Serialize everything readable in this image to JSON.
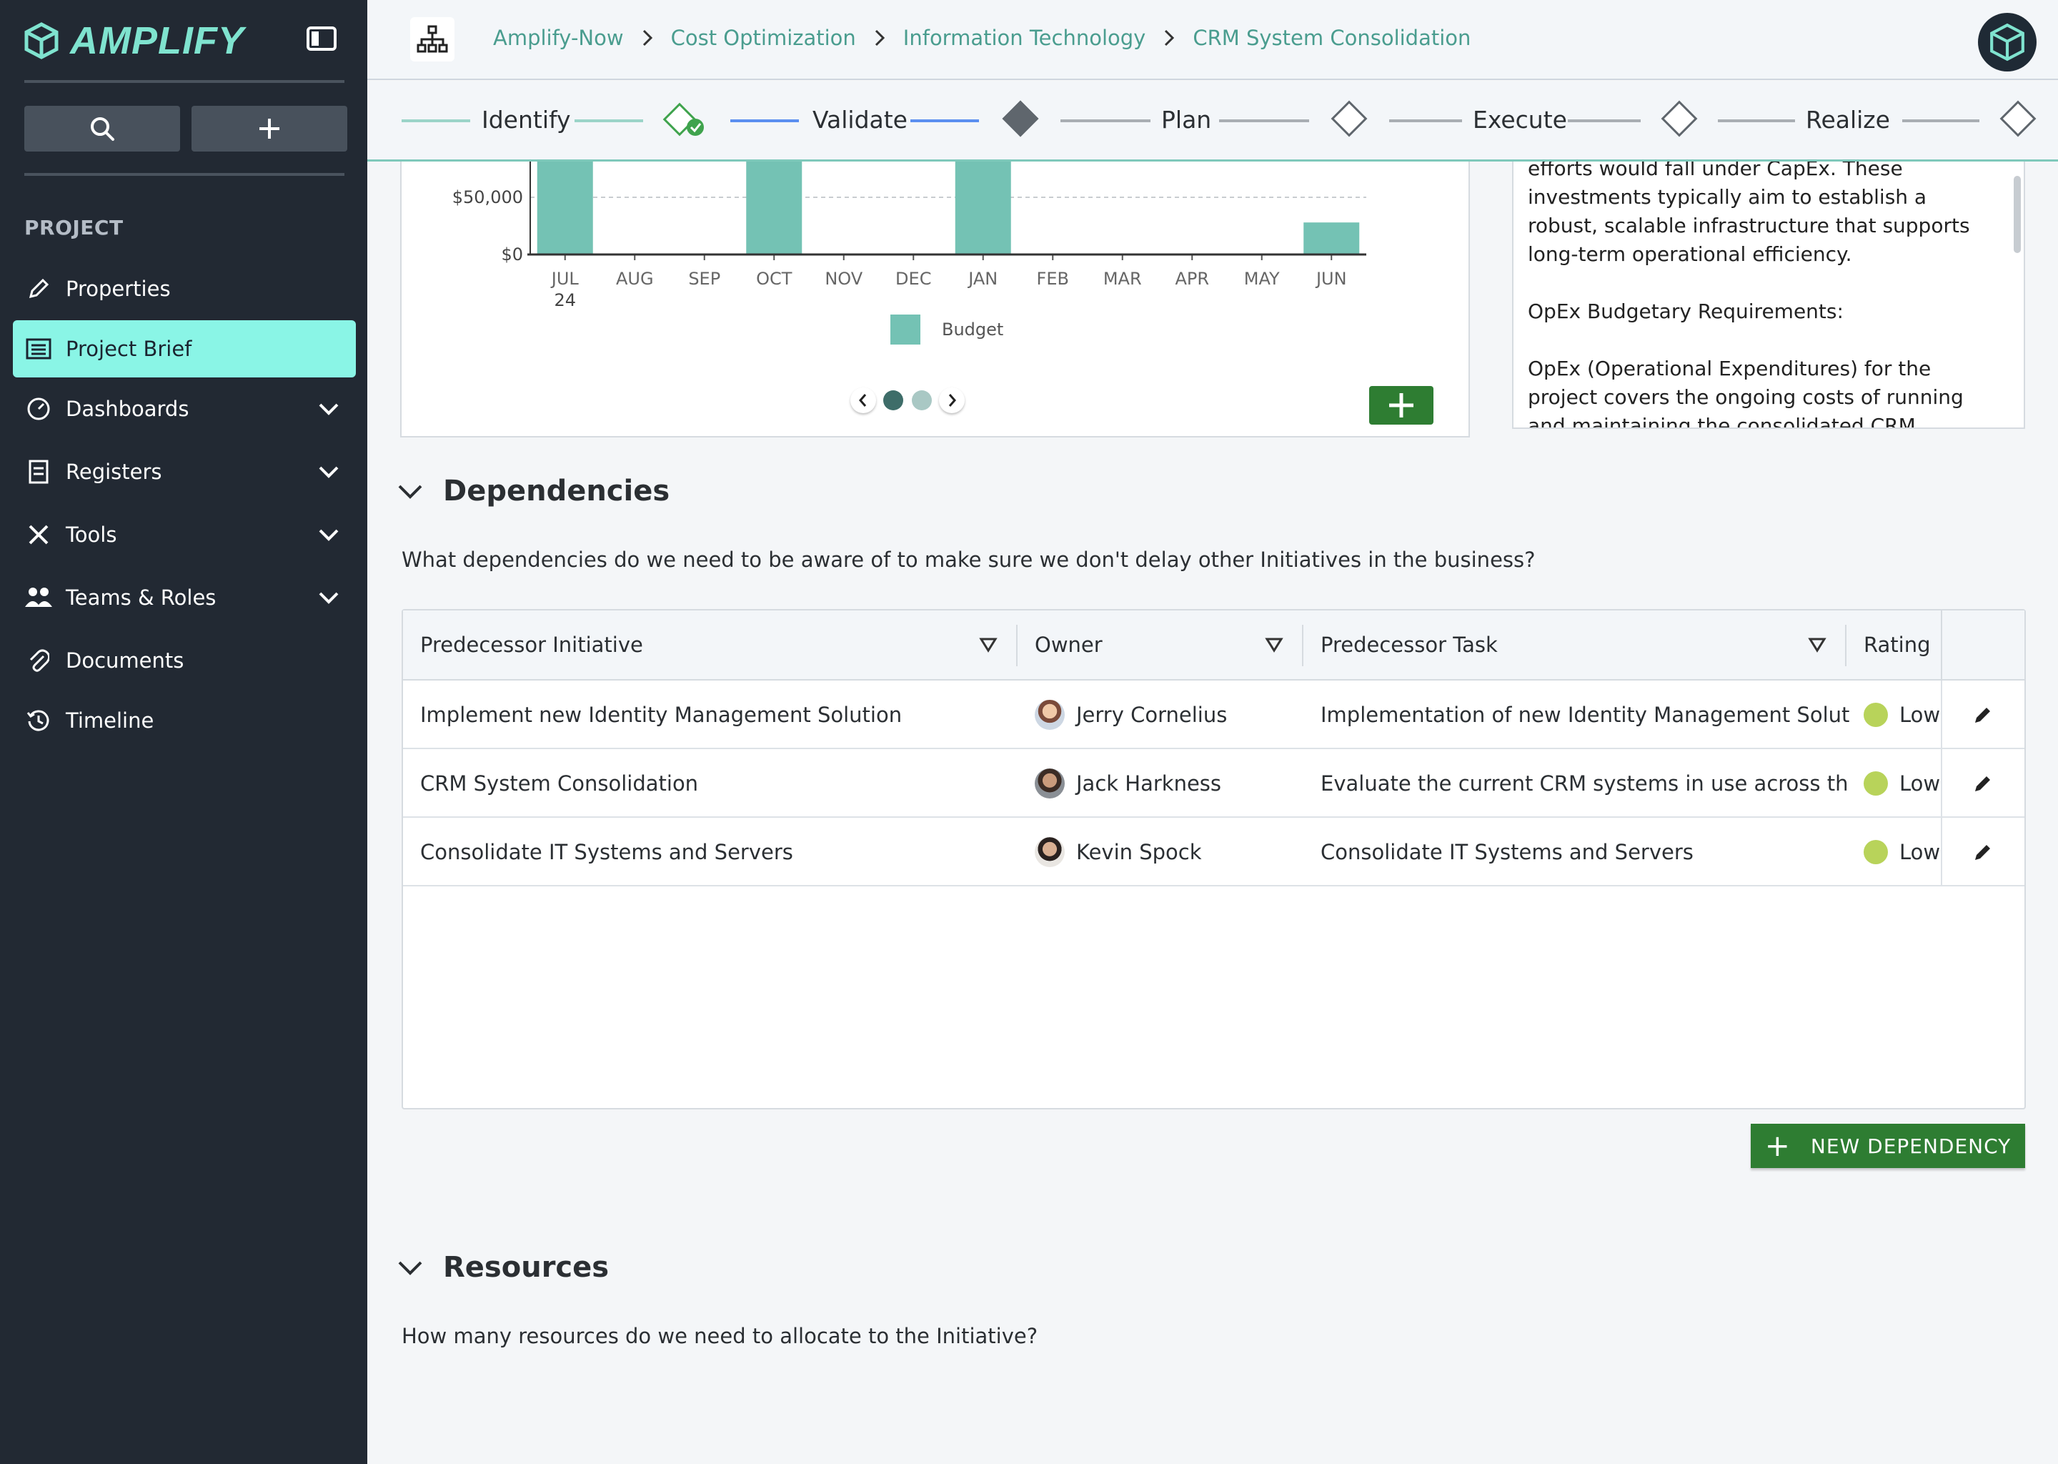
{
  "app": {
    "logo_text": "AMPLIFY"
  },
  "sidebar": {
    "section_label": "PROJECT",
    "items": [
      {
        "label": "Properties",
        "icon": "pencil-icon",
        "has_chevron": false,
        "active": false
      },
      {
        "label": "Project Brief",
        "icon": "list-icon",
        "has_chevron": false,
        "active": true
      },
      {
        "label": "Dashboards",
        "icon": "dashboard-icon",
        "has_chevron": true,
        "active": false
      },
      {
        "label": "Registers",
        "icon": "register-icon",
        "has_chevron": true,
        "active": false
      },
      {
        "label": "Tools",
        "icon": "tools-icon",
        "has_chevron": true,
        "active": false
      },
      {
        "label": "Teams & Roles",
        "icon": "team-icon",
        "has_chevron": true,
        "active": false
      },
      {
        "label": "Documents",
        "icon": "paperclip-icon",
        "has_chevron": false,
        "active": false
      },
      {
        "label": "Timeline",
        "icon": "history-icon",
        "has_chevron": false,
        "active": false
      }
    ]
  },
  "breadcrumb": [
    "Amplify-Now",
    "Cost Optimization",
    "Information Technology",
    "CRM System Consolidation"
  ],
  "stages": [
    {
      "label": "Identify",
      "status": "complete"
    },
    {
      "label": "Validate",
      "status": "current"
    },
    {
      "label": "Plan",
      "status": "pending"
    },
    {
      "label": "Execute",
      "status": "pending"
    },
    {
      "label": "Realize",
      "status": "pending"
    }
  ],
  "chart_data": {
    "type": "bar",
    "categories": [
      "JUL 24",
      "AUG",
      "SEP",
      "OCT",
      "NOV",
      "DEC",
      "JAN",
      "FEB",
      "MAR",
      "APR",
      "MAY",
      "JUN"
    ],
    "tick_labels": {
      "first_line": [
        "JUL",
        "AUG",
        "SEP",
        "OCT",
        "NOV",
        "DEC",
        "JAN",
        "FEB",
        "MAR",
        "APR",
        "MAY",
        "JUN"
      ],
      "second_line": [
        "24",
        "",
        "",
        "",
        "",
        "",
        "",
        "",
        "",
        "",
        "",
        ""
      ]
    },
    "series": [
      {
        "name": "Budget",
        "color": "#74c2b4",
        "values": [
          null,
          0,
          0,
          null,
          0,
          0,
          null,
          0,
          0,
          0,
          0,
          28000
        ]
      }
    ],
    "clipped_note": "JUL, OCT, JAN bars extend above the visible area",
    "yticks": [
      "$50,000",
      "$0"
    ],
    "ylim": [
      0,
      75000
    ],
    "grid": "dashed at $50,000",
    "legend": "bottom-center",
    "carousel": {
      "pages": 2,
      "active_page": 1
    }
  },
  "brief_text": [
    "efforts would fall under CapEx. These investments typically aim to establish a robust, scalable infrastructure that supports long-term operational efficiency.",
    "OpEx Budgetary Requirements:",
    "OpEx (Operational Expenditures) for the project covers the ongoing costs of running and maintaining the consolidated CRM system. This"
  ],
  "dependencies": {
    "title": "Dependencies",
    "question": "What dependencies do we need to be aware of to make sure we don't delay other Initiatives in the business?",
    "columns": [
      "Predecessor Initiative",
      "Owner",
      "Predecessor Task",
      "Rating"
    ],
    "rows": [
      {
        "initiative": "Implement new Identity Management Solution",
        "owner": "Jerry Cornelius",
        "task": "Implementation of new Identity Management Solution",
        "rating": "Low"
      },
      {
        "initiative": "CRM System Consolidation",
        "owner": "Jack Harkness",
        "task": "Evaluate the current CRM systems in use across the ...",
        "rating": "Low"
      },
      {
        "initiative": "Consolidate IT Systems and Servers",
        "owner": "Kevin Spock",
        "task": "Consolidate IT Systems and Servers",
        "rating": "Low"
      }
    ],
    "new_button": "NEW DEPENDENCY"
  },
  "resources": {
    "title": "Resources",
    "question": "How many resources do we need to allocate to the Initiative?"
  },
  "colors": {
    "accent": "#8af5e6",
    "teal": "#74c2b4",
    "green": "#2e7d32",
    "sidebar": "#222933",
    "rating_low": "#b8d35a"
  }
}
